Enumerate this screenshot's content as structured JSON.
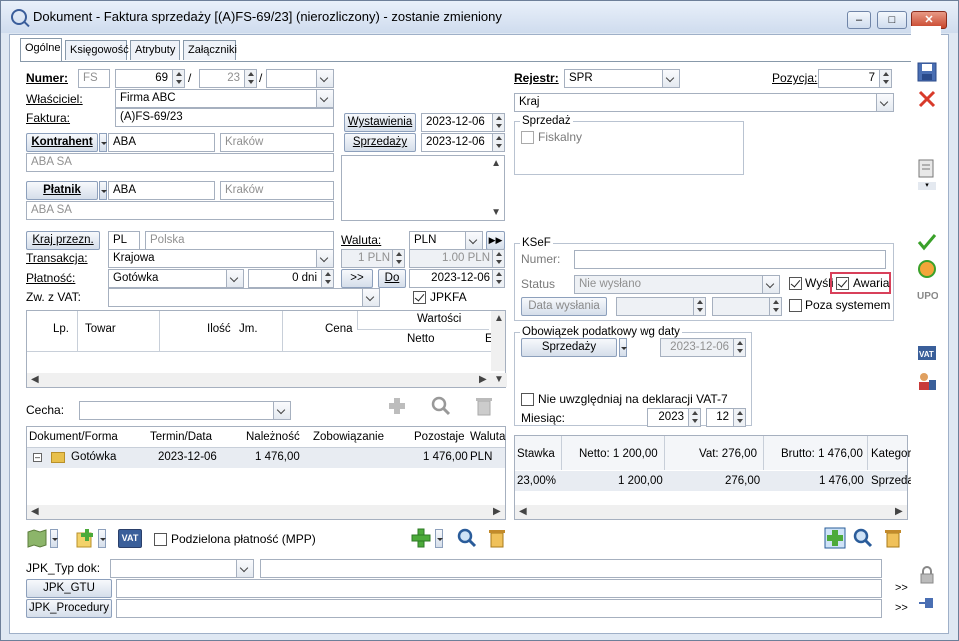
{
  "window": {
    "title": "Dokument - Faktura sprzedaży [(A)FS-69/23] (nierozliczony) - zostanie zmieniony",
    "controls": [
      "–",
      "□",
      "✕"
    ]
  },
  "tabs": [
    "Ogólne",
    "Księgowość",
    "Atrybuty",
    "Załączniki"
  ],
  "header": {
    "numer_label": "Numer:",
    "numer_prefix": "FS",
    "numer_value": "69",
    "numer_month": "23",
    "slash": "/",
    "wlasciciel_label": "Właściciel:",
    "wlasciciel_value": "Firma ABC",
    "faktura_label": "Faktura:",
    "faktura_value": "(A)FS-69/23",
    "rejestr_label": "Rejestr:",
    "rejestr_value": "SPR",
    "pozycja_label": "Pozycja:",
    "pozycja_value": "7",
    "kraj_value": "Kraj"
  },
  "dates": {
    "wystawienia_label": "Wystawienia",
    "wystawienia_value": "2023-12-06",
    "sprzedazy_label": "Sprzedaży",
    "sprzedazy_value": "2023-12-06"
  },
  "kontrahent": {
    "label": "Kontrahent",
    "code": "ABA",
    "city": "Kraków",
    "name": "ABA SA"
  },
  "platnik": {
    "label": "Płatnik",
    "code": "ABA",
    "city": "Kraków",
    "name": "ABA SA"
  },
  "sprzedaz": {
    "group_label": "Sprzedaż",
    "fiskalny_label": "Fiskalny"
  },
  "details": {
    "kraj_przezn_label": "Kraj przezn.",
    "kraj_code": "PL",
    "kraj_name": "Polska",
    "waluta_label": "Waluta:",
    "waluta_value": "PLN",
    "transakcja_label": "Transakcja:",
    "transakcja_value": "Krajowa",
    "rate1": "1 PLN",
    "rate2": "1.00 PLN",
    "platnosc_label": "Płatność:",
    "platnosc_value": "Gotówka",
    "dni_value": "0 dni",
    "arrow_btn": ">>",
    "do_label": "Do",
    "do_value": "2023-12-06",
    "zw_vat_label": "Zw. z VAT:",
    "jpkfa_label": "JPKFA"
  },
  "ksef": {
    "group_label": "KSeF",
    "numer_label": "Numer:",
    "status_label": "Status",
    "status_value": "Nie wysłano",
    "wyslij_label": "Wyśli",
    "awaria_label": "Awaria",
    "data_wyslania_label": "Data wysłania",
    "poza_label": "Poza systemem"
  },
  "items_table": {
    "wartosci_label": "Wartości",
    "columns": [
      "Lp.",
      "Towar",
      "Ilość",
      "Jm.",
      "Cena",
      "Netto",
      "E"
    ]
  },
  "obowiazek": {
    "group_label": "Obowiązek podatkowy wg daty",
    "button_label": "Sprzedaży",
    "date_value": "2023-12-06",
    "nie_uwzgl_label": "Nie uwzględniaj na deklaracji VAT-7",
    "miesiac_label": "Miesiąc:",
    "year_value": "2023",
    "month_value": "12"
  },
  "cecha_label": "Cecha:",
  "payments_table": {
    "columns": [
      "Dokument/Forma",
      "Termin/Data",
      "Należność",
      "Zobowiązanie",
      "Pozostaje",
      "Waluta"
    ],
    "rows": [
      {
        "forma": "Gotówka",
        "termin": "2023-12-06",
        "naleznosc": "1 476,00",
        "zobowiazanie": "",
        "pozostaje": "1 476,00",
        "waluta": "PLN"
      }
    ]
  },
  "vat_table": {
    "columns": [
      "Stawka",
      "Netto: 1 200,00",
      "Vat: 276,00",
      "Brutto: 1 476,00",
      "Kategor"
    ],
    "rows": [
      {
        "stawka": "23,00%",
        "netto": "1 200,00",
        "vat": "276,00",
        "brutto": "1 476,00",
        "kategoria": "Sprzeda"
      }
    ]
  },
  "bottom": {
    "mpp_label": "Podzielona płatność (MPP)",
    "jpk_typ_label": "JPK_Typ dok:",
    "jpk_gtu_label": "JPK_GTU",
    "jpk_procedury_label": "JPK_Procedury",
    "more_btn": ">>",
    "vat_btn": "VAT"
  }
}
